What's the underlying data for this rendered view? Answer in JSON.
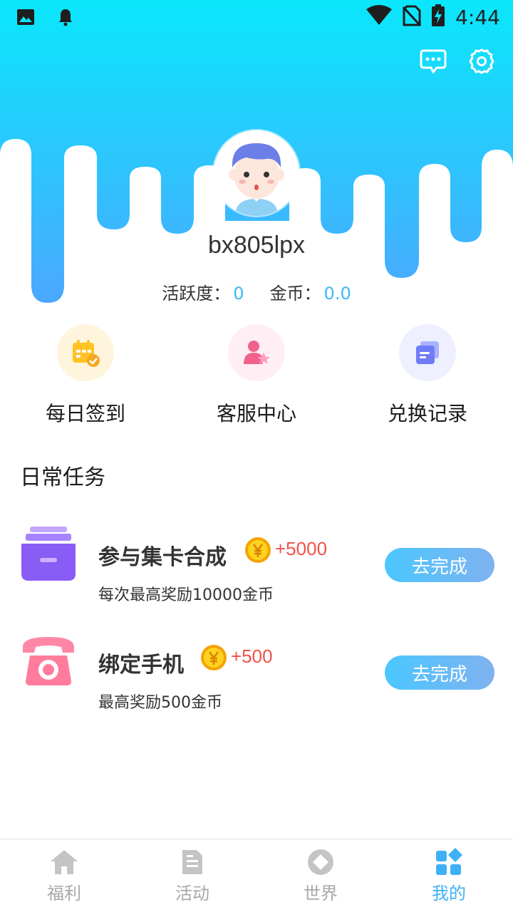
{
  "status_bar": {
    "time": "4:44"
  },
  "colors": {
    "accent": "#3db8f5",
    "header_top": "#0ae7fb",
    "header_bottom": "#4ba8ff",
    "reward_red": "#f0524a"
  },
  "header_icons": [
    "chat-icon",
    "gear-icon"
  ],
  "profile": {
    "username": "bx805lpx",
    "activity_label": "活跃度：",
    "activity_value": "0",
    "coins_label": "金币：",
    "coins_value": "0.0"
  },
  "quick_actions": [
    {
      "label": "每日签到",
      "icon": "calendar-check-icon"
    },
    {
      "label": "客服中心",
      "icon": "customer-service-icon"
    },
    {
      "label": "兑换记录",
      "icon": "exchange-record-icon"
    }
  ],
  "daily_tasks": {
    "title": "日常任务",
    "items": [
      {
        "name": "参与集卡合成",
        "reward": "+5000",
        "description": "每次最高奖励10000金币",
        "button": "去完成",
        "icon": "card-box-icon"
      },
      {
        "name": "绑定手机",
        "reward": "+500",
        "description": "最高奖励500金币",
        "button": "去完成",
        "icon": "telephone-icon"
      }
    ]
  },
  "bottom_nav": [
    {
      "label": "福利",
      "icon": "home-icon",
      "active": false
    },
    {
      "label": "活动",
      "icon": "document-icon",
      "active": false
    },
    {
      "label": "世界",
      "icon": "world-icon",
      "active": false
    },
    {
      "label": "我的",
      "icon": "grid-icon",
      "active": true
    }
  ]
}
